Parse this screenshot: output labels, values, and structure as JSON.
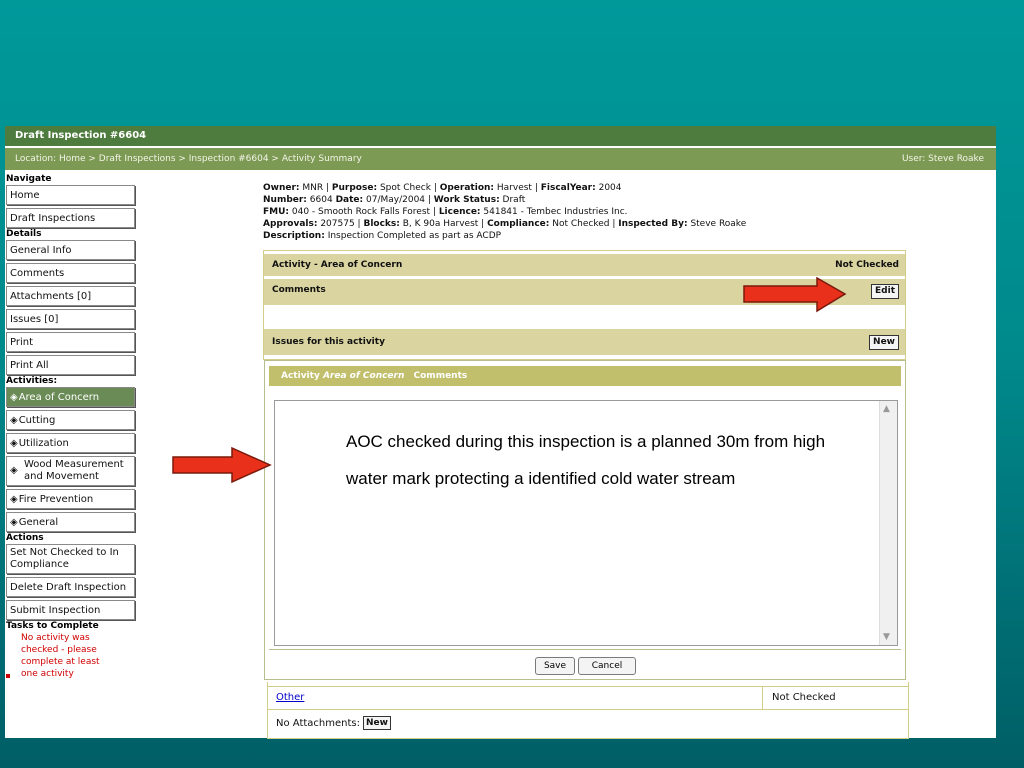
{
  "window": {
    "title": "Draft Inspection #6604",
    "location": "Location: Home > Draft Inspections > Inspection #6604 > Activity Summary",
    "user": "User: Steve Roake"
  },
  "sidebar": {
    "navigate_heading": "Navigate",
    "navigate": [
      "Home",
      "Draft Inspections"
    ],
    "details_heading": "Details",
    "details": [
      "General Info",
      "Comments",
      "Attachments [0]",
      "Issues [0]",
      "Print",
      "Print All"
    ],
    "activities_heading": "Activities:",
    "activities": [
      {
        "label": "Area of Concern",
        "active": true
      },
      {
        "label": "Cutting",
        "active": false
      },
      {
        "label": "Utilization",
        "active": false
      },
      {
        "label_line1": "Wood Measurement",
        "label_line2": "and Movement",
        "active": false
      },
      {
        "label": "Fire Prevention",
        "active": false
      },
      {
        "label": "General",
        "active": false
      }
    ],
    "actions_heading": "Actions",
    "actions": [
      {
        "line1": "Set Not Checked to In",
        "line2": "Compliance"
      },
      {
        "line1": "Delete Draft Inspection"
      },
      {
        "line1": "Submit Inspection"
      }
    ],
    "tasks_heading": "Tasks to Complete",
    "tasks_lines": [
      "No activity was",
      "checked - please",
      "complete at least",
      "one activity"
    ]
  },
  "info": {
    "line1": {
      "owner_label": "Owner:",
      "owner": "MNR",
      "purpose_label": "Purpose:",
      "purpose": "Spot Check",
      "operation_label": "Operation:",
      "operation": "Harvest",
      "fiscal_label": "FiscalYear:",
      "fiscal": "2004"
    },
    "line2": {
      "number_label": "Number:",
      "number": "6604",
      "date_label": "Date:",
      "date": "07/May/2004",
      "work_label": "Work Status:",
      "work": "Draft"
    },
    "line3": {
      "fmu_label": "FMU:",
      "fmu": "040 - Smooth Rock Falls Forest",
      "licence_label": "Licence:",
      "licence": "541841 - Tembec Industries Inc."
    },
    "line4": {
      "approvals_label": "Approvals:",
      "approvals": "207575",
      "blocks_label": "Blocks:",
      "blocks": "B, K 90a Harvest",
      "compliance_label": "Compliance:",
      "compliance": "Not Checked",
      "inspected_label": "Inspected By:",
      "inspected": "Steve Roake"
    },
    "line5": {
      "description_label": "Description:",
      "description": "Inspection Completed as part as ACDP"
    }
  },
  "activity_panel": {
    "activity_label": "Activity - Area of Concern",
    "activity_status": "Not Checked",
    "comments_label": "Comments",
    "edit_button": "Edit",
    "issues_label": "Issues for this activity",
    "new_button": "New"
  },
  "dialog": {
    "title_prefix": "Activity ",
    "title_italic": "Area of Concern",
    "title_suffix": " Comments",
    "comment_text": "AOC checked during this inspection is a planned 30m from high water mark protecting a identified cold water stream",
    "save_button": "Save",
    "cancel_button": "Cancel"
  },
  "bottom": {
    "other_link": "Other",
    "other_status": "Not Checked",
    "attachments_label": "No Attachments:",
    "new_button": "New"
  },
  "colors": {
    "titlebar": "#4e7c3e",
    "locbar": "#7c9a54",
    "panel_bar": "#d9d4a0",
    "dialog_title": "#c2bf6c",
    "arrow": "#e8301a",
    "task_text": "#d00000"
  }
}
